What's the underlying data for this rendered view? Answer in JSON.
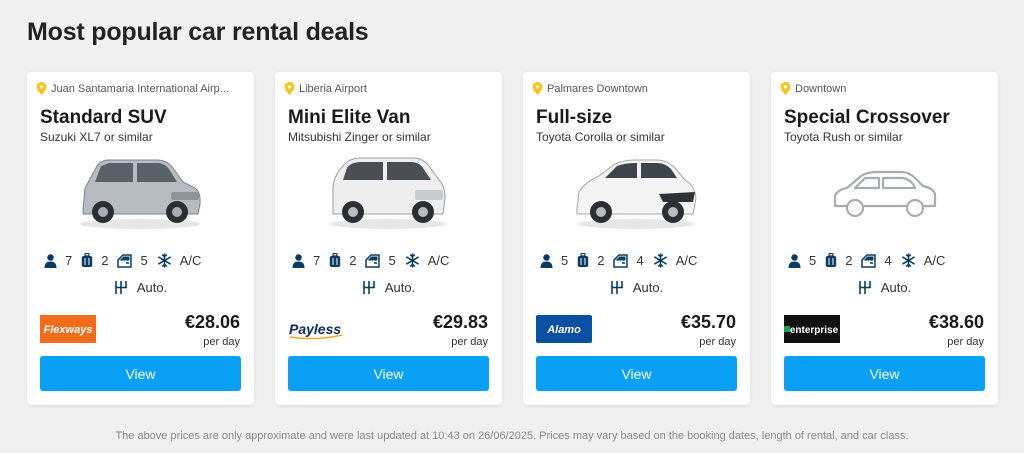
{
  "page": {
    "title": "Most popular car rental deals",
    "footnote": "The above prices are only approximate and were last updated at 10:43 on 26/06/2025. Prices may vary based on the booking dates, length of rental, and car class."
  },
  "colors": {
    "accent": "#0aa0f5",
    "pin": "#f5c518",
    "icon": "#0b3b60"
  },
  "cards": [
    {
      "location": "Juan Santamaria International Airp...",
      "name": "Standard SUV",
      "model": "Suzuki XL7 or similar",
      "passengers": "7",
      "bags": "2",
      "doors": "5",
      "ac": "A/C",
      "transmission": "Auto.",
      "brand": "Flexways",
      "price": "€28.06",
      "per": "per day",
      "button": "View",
      "image": "silver-suv-photo"
    },
    {
      "location": "Liberia Airport",
      "name": "Mini Elite Van",
      "model": "Mitsubishi Zinger or similar",
      "passengers": "7",
      "bags": "2",
      "doors": "5",
      "ac": "A/C",
      "transmission": "Auto.",
      "brand": "Payless",
      "price": "€29.83",
      "per": "per day",
      "button": "View",
      "image": "white-van-photo"
    },
    {
      "location": "Palmares Downtown",
      "name": "Full-size",
      "model": "Toyota Corolla or similar",
      "passengers": "5",
      "bags": "2",
      "doors": "4",
      "ac": "A/C",
      "transmission": "Auto.",
      "brand": "Alamo",
      "price": "€35.70",
      "per": "per day",
      "button": "View",
      "image": "white-hatchback-photo"
    },
    {
      "location": "Downtown",
      "name": "Special Crossover",
      "model": "Toyota Rush or similar",
      "passengers": "5",
      "bags": "2",
      "doors": "4",
      "ac": "A/C",
      "transmission": "Auto.",
      "brand": "enterprise",
      "price": "€38.60",
      "per": "per day",
      "button": "View",
      "image": "car-outline-placeholder"
    }
  ]
}
